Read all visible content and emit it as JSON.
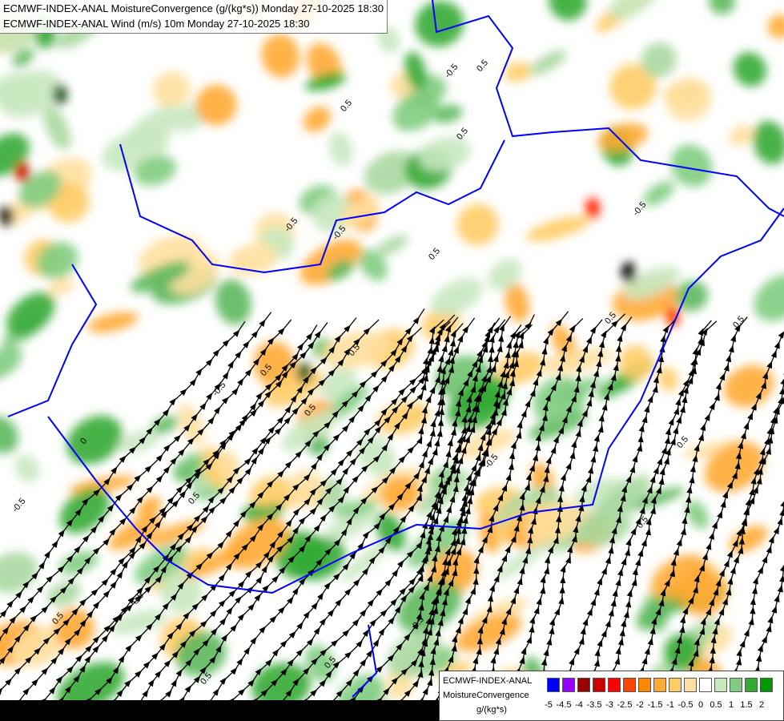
{
  "title": {
    "line1": "ECMWF-INDEX-ANAL MoistureConvergence (g/(kg*s)) Monday 27-10-2025 18:30",
    "line2": "ECMWF-INDEX-ANAL Wind (m/s) 10m Monday 27-10-2025 18:30"
  },
  "colors": {
    "background": "#ffffff",
    "border": "#0000ff",
    "streamline": "#000000",
    "contour_label": "#000000"
  },
  "legend": {
    "model": "ECMWF-INDEX-ANAL",
    "variable": "MoistureConvergence",
    "unit": "g/(kg*s)",
    "labels": [
      "-5",
      "-4.5",
      "-4",
      "-3.5",
      "-3",
      "-2.5",
      "-2",
      "-1.5",
      "-1",
      "-0.5",
      "0",
      "0.5",
      "1",
      "1.5",
      "2"
    ],
    "colors": [
      "#0000ff",
      "#9900ff",
      "#990000",
      "#cc0000",
      "#ff0000",
      "#ff4400",
      "#ff8800",
      "#ffaa33",
      "#ffcc66",
      "#ffe0a0",
      "#ffffff",
      "#c8e8c0",
      "#80cc80",
      "#33aa33",
      "#009900"
    ]
  },
  "contour_labels": [
    "-0.5",
    "0.5",
    "0.5",
    "-0.5",
    "0.5",
    "-0.5",
    "0.5",
    "0.5",
    "0.5",
    "-0.5",
    "0.5",
    "0",
    "-0.5",
    "0.5",
    "0.5",
    "0.5",
    "-0.5",
    "0.5",
    "0.5",
    "0.5",
    "-0.5",
    "0.5",
    "0.5",
    "0.5",
    "0.5"
  ]
}
